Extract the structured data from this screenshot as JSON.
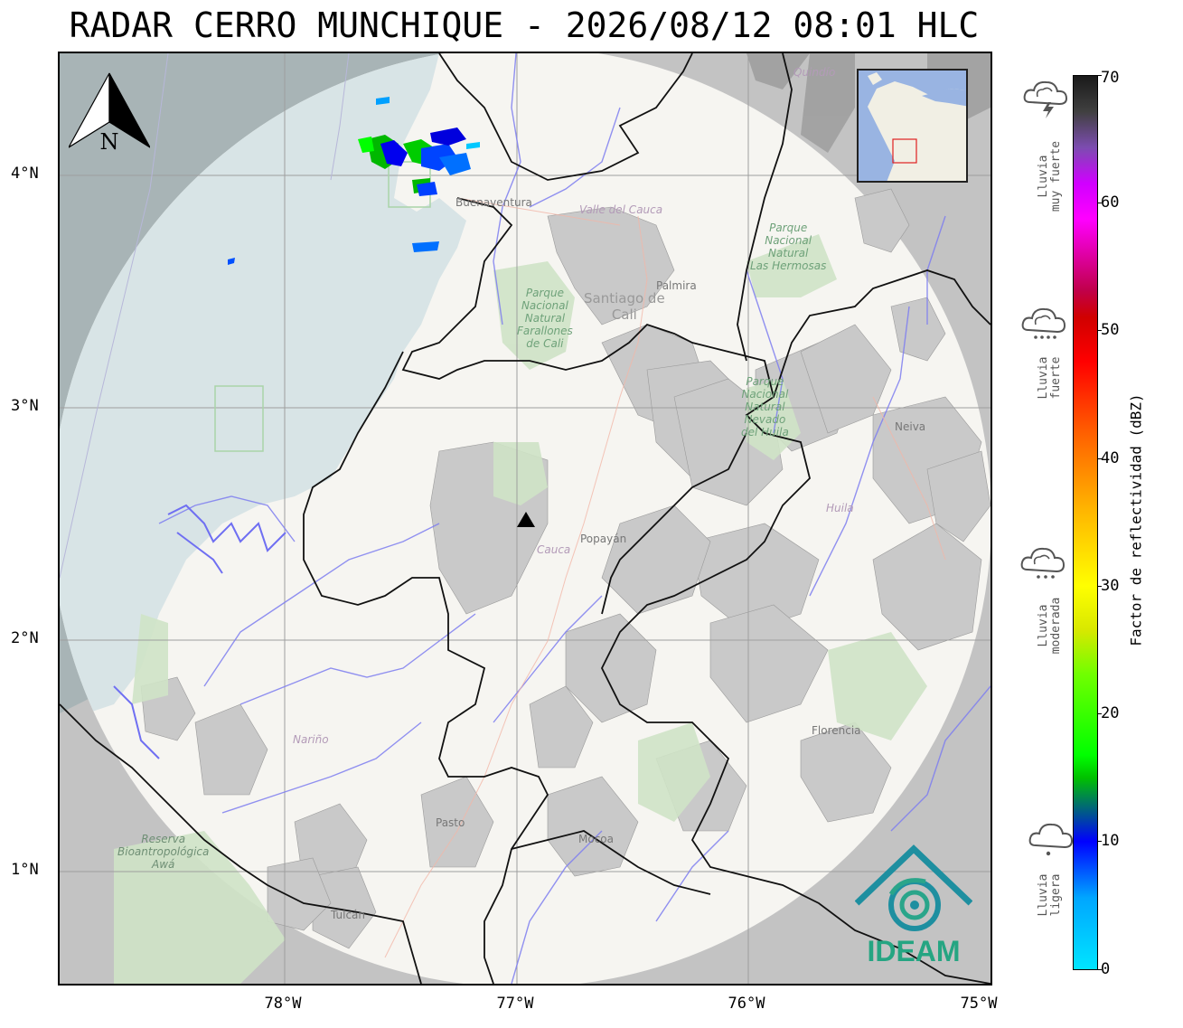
{
  "title": "RADAR CERRO MUNCHIQUE - 2026/08/12 08:01 HLC",
  "axes": {
    "latitude_labels": [
      "4°N",
      "3°N",
      "2°N",
      "1°N"
    ],
    "longitude_labels": [
      "78°W",
      "77°W",
      "76°W",
      "75°W"
    ]
  },
  "colorbar": {
    "label": "Factor de reflectividad (dBZ)",
    "ticks": [
      "0",
      "10",
      "20",
      "30",
      "40",
      "50",
      "60",
      "70"
    ]
  },
  "rain_categories": [
    {
      "label": "Lluvia\nmuy fuerte",
      "icon": "storm-cloud-icon"
    },
    {
      "label": "Lluvia\nfuerte",
      "icon": "heavy-rain-cloud-icon"
    },
    {
      "label": "Lluvia\nmoderada",
      "icon": "moderate-rain-cloud-icon"
    },
    {
      "label": "Lluvia\nligera",
      "icon": "light-rain-cloud-icon"
    }
  ],
  "map_labels": {
    "buenaventura": "Buenaventura",
    "valle": "Valle del Cauca",
    "pnn_farallones": "Parque\nNacional\nNatural\nFarallones\nde Cali",
    "cali": "Santiago de\nCali",
    "palmira": "Palmira",
    "pnn_hermosas": "Parque\nNacional\nNatural\nLas Hermosas",
    "quindio": "Quindío",
    "pnn_huila": "Parque\nNacional\nNatural\nNevado\ndel Huila",
    "neiva": "Neiva",
    "huila": "Huila",
    "popayan": "Popayán",
    "cauca": "Cauca",
    "narino": "Nariño",
    "florencia": "Florencia",
    "pasto": "Pasto",
    "mocoa": "Mocoa",
    "reserva": "Reserva\nBioantropológica\nAwá",
    "tulcan": "Tulcán"
  },
  "logo_text": "IDEAM",
  "north_label": "N",
  "radar_site": {
    "name": "Cerro Munchique",
    "lat": 2.53,
    "lon": -76.96
  }
}
